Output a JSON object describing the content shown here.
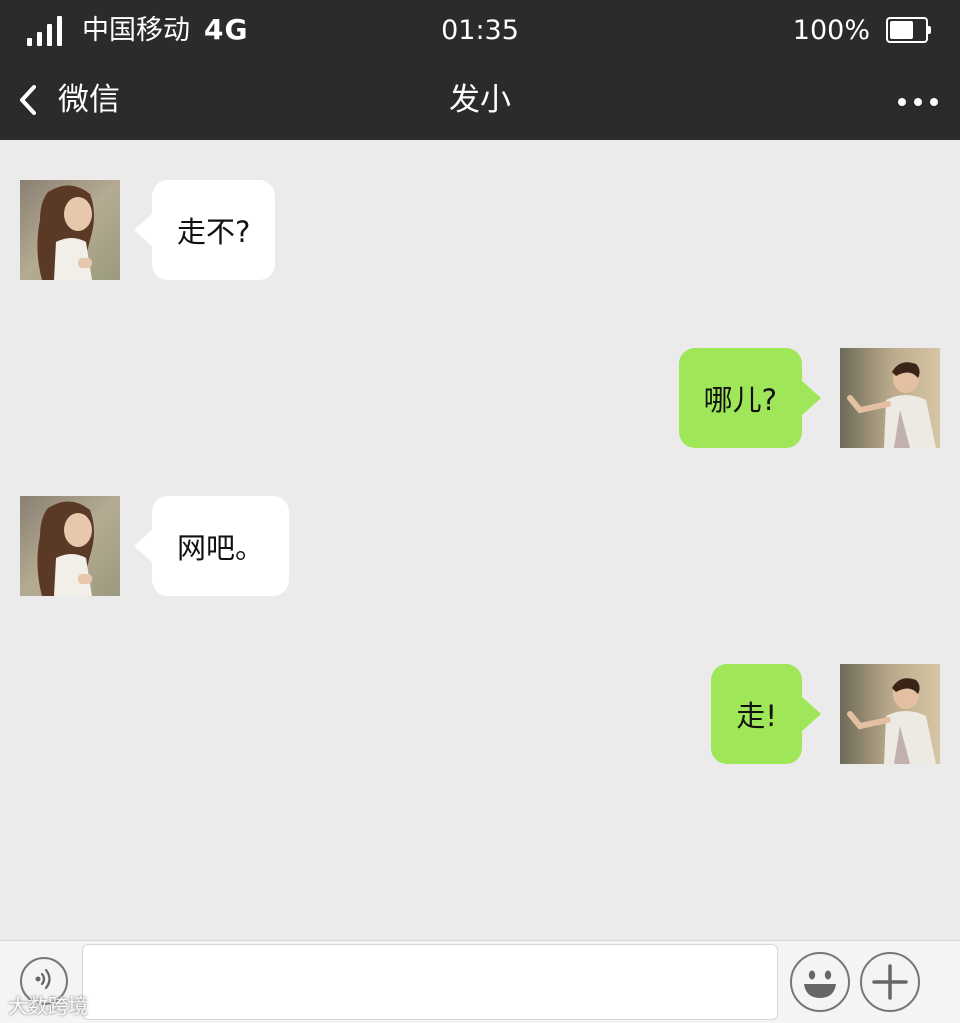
{
  "status_bar": {
    "carrier": "中国移动",
    "network": "4G",
    "time": "01:35",
    "battery": "100%",
    "battery_level": 0.75
  },
  "nav": {
    "back_label": "微信",
    "title": "发小"
  },
  "messages": [
    {
      "side": "left",
      "sender_avatar": "girl-avatar",
      "text": "走不?"
    },
    {
      "side": "right",
      "sender_avatar": "boy-avatar",
      "text": "哪儿?"
    },
    {
      "side": "left",
      "sender_avatar": "girl-avatar",
      "text": "网吧。"
    },
    {
      "side": "right",
      "sender_avatar": "boy-avatar",
      "text": "走!"
    }
  ],
  "input_bar": {
    "voice_icon": "voice-icon",
    "emoji_icon": "emoji-icon",
    "plus_icon": "plus-icon",
    "input_value": ""
  },
  "watermark": "大数跨境",
  "colors": {
    "bar": "#2b2b2d",
    "chat_bg": "#ebebeb",
    "own_bubble": "#9fe658",
    "other_bubble": "#ffffff"
  }
}
